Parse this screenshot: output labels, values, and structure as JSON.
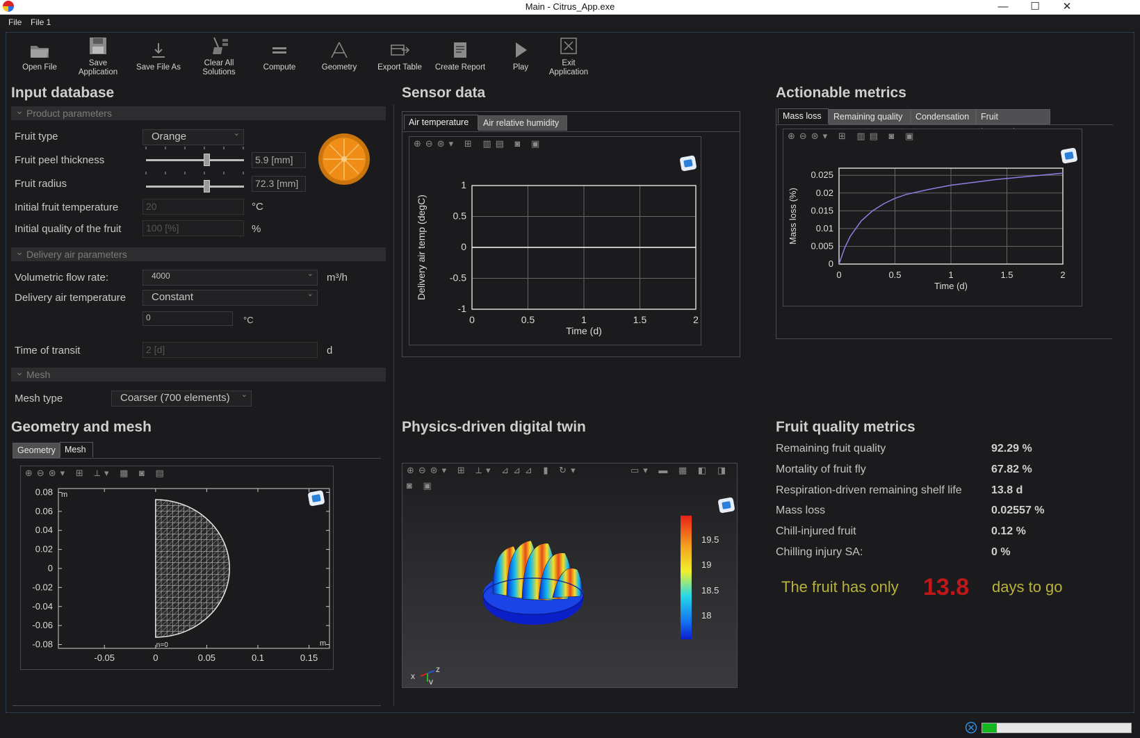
{
  "window": {
    "title": "Main - Citrus_App.exe",
    "minimize": "—",
    "maximize": "☐",
    "close": "✕"
  },
  "menu": [
    "File",
    "File 1"
  ],
  "toolbar": [
    {
      "label": "Open File",
      "icon": "folder-icon"
    },
    {
      "label": "Save\nApplication",
      "icon": "save-icon"
    },
    {
      "label": "Save File As",
      "icon": "download-icon"
    },
    {
      "label": "Clear All\nSolutions",
      "icon": "broom-icon"
    },
    {
      "label": "Compute",
      "icon": "compute-icon"
    },
    {
      "label": "Geometry",
      "icon": "geometry-icon"
    },
    {
      "label": "Export Table",
      "icon": "export-table-icon"
    },
    {
      "label": "Create Report",
      "icon": "report-icon"
    },
    {
      "label": "Play",
      "icon": "play-icon"
    },
    {
      "label": "Exit\nApplication",
      "icon": "exit-icon"
    }
  ],
  "input": {
    "title": "Input database",
    "product_header": "Product parameters",
    "fruit_type_label": "Fruit type",
    "fruit_type_value": "Orange",
    "peel_label": "Fruit peel thickness",
    "peel_value": "5.9 [mm]",
    "peel_slider_fraction": 0.62,
    "radius_label": "Fruit radius",
    "radius_value": "72.3 [mm]",
    "radius_slider_fraction": 0.62,
    "init_temp_label": "Initial fruit temperature",
    "init_temp_value": "20",
    "init_temp_unit": "°C",
    "init_quality_label": "Initial quality of the fruit",
    "init_quality_value": "100 [%]",
    "init_quality_unit": "%",
    "delivery_header": "Delivery air parameters",
    "flow_label": "Volumetric flow rate:",
    "flow_value": "4000",
    "flow_unit": "m³/h",
    "air_temp_label": "Delivery air temperature",
    "air_temp_value": "Constant",
    "air_temp_num": "0",
    "air_temp_unit": "°C",
    "transit_label": "Time of transit",
    "transit_value": "2 [d]",
    "transit_unit": "d",
    "mesh_header": "Mesh",
    "mesh_label": "Mesh type",
    "mesh_value": "Coarser (700 elements)"
  },
  "geometry": {
    "title": "Geometry and mesh",
    "tabs": [
      "Geometry",
      "Mesh"
    ],
    "axis_unit": "m",
    "n_label": "n=0",
    "yticks": [
      "0.08",
      "0.06",
      "0.04",
      "0.02",
      "0",
      "-0.02",
      "-0.04",
      "-0.06",
      "-0.08"
    ],
    "xticks": [
      "-0.05",
      "0",
      "0.05",
      "0.1",
      "0.15"
    ]
  },
  "sensor": {
    "title": "Sensor data",
    "tabs": [
      "Air temperature",
      "Air relative humidity"
    ]
  },
  "actionable": {
    "title": "Actionable metrics",
    "tabs": [
      "Mass loss",
      "Remaining quality",
      "Condensation",
      "Fruit temperature"
    ]
  },
  "twin": {
    "title": "Physics-driven digital twin",
    "colorbar_ticks": [
      "19.5",
      "19",
      "18.5",
      "18"
    ],
    "axes_labels": [
      "x",
      "y",
      "z"
    ]
  },
  "quality": {
    "title": "Fruit quality metrics",
    "rows": [
      {
        "k": "Remaining fruit quality",
        "v": "92.29 %"
      },
      {
        "k": "Mortality of fruit fly",
        "v": "67.82 %"
      },
      {
        "k": "Respiration-driven remaining shelf life",
        "v": "13.8 d"
      },
      {
        "k": "Mass loss",
        "v": "0.02557 %"
      },
      {
        "k": "Chill-injured fruit",
        "v": "0.12 %"
      },
      {
        "k": "Chilling injury SA:",
        "v": "0 %"
      }
    ],
    "days_prefix": "The fruit has only",
    "days_value": "13.8",
    "days_suffix": "days to go"
  },
  "status": {
    "progress_fraction": 0.1
  },
  "chart_data": [
    {
      "type": "line",
      "ylabel": "Delivery air temp (degC)",
      "xlabel": "Time (d)",
      "xlim": [
        0,
        2
      ],
      "ylim": [
        -1,
        1
      ],
      "xticks": [
        0,
        0.5,
        1,
        1.5,
        2
      ],
      "yticks": [
        1,
        0.5,
        0,
        -0.5,
        -1
      ],
      "grid": true,
      "series": [
        {
          "x": [
            0,
            2
          ],
          "y": [
            0,
            0
          ],
          "color": "#ffffff"
        }
      ]
    },
    {
      "type": "line",
      "ylabel": "Mass loss (%)",
      "xlabel": "Time (d)",
      "xlim": [
        0,
        2
      ],
      "ylim": [
        0,
        0.027
      ],
      "xticks": [
        0,
        0.5,
        1,
        1.5,
        2
      ],
      "yticks": [
        0.025,
        0.02,
        0.015,
        0.01,
        0.005,
        0
      ],
      "grid": true,
      "series": [
        {
          "x": [
            0,
            0.05,
            0.1,
            0.2,
            0.3,
            0.4,
            0.5,
            0.6,
            0.8,
            1.0,
            1.2,
            1.4,
            1.6,
            1.8,
            2.0
          ],
          "y": [
            0,
            0.0045,
            0.0078,
            0.0122,
            0.015,
            0.017,
            0.0185,
            0.0196,
            0.021,
            0.0222,
            0.023,
            0.0238,
            0.0244,
            0.025,
            0.0256
          ],
          "color": "#8a80e6"
        }
      ]
    }
  ]
}
